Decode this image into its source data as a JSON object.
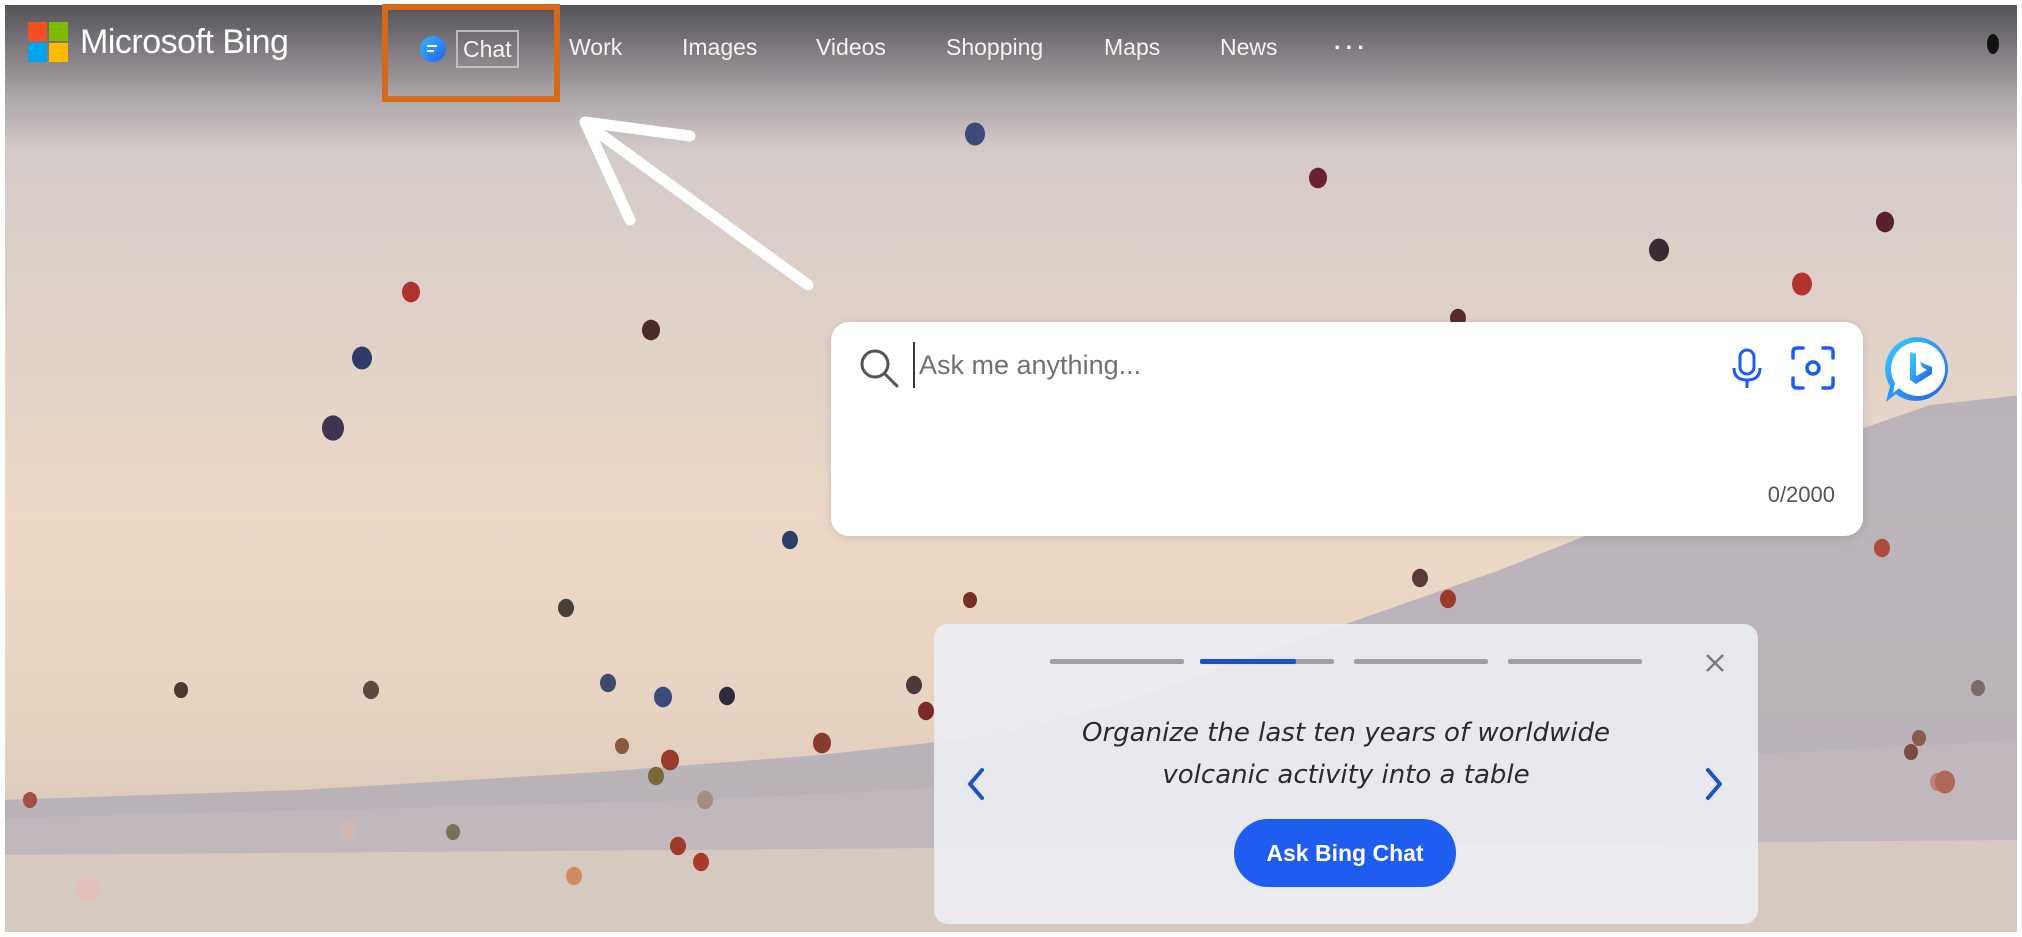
{
  "brand": {
    "name": "Microsoft Bing",
    "logo_colors": [
      "#f25022",
      "#7fba00",
      "#00a4ef",
      "#ffb900"
    ]
  },
  "nav": {
    "items": [
      {
        "label": "Chat",
        "icon": "chat-bubble-icon"
      },
      {
        "label": "Work"
      },
      {
        "label": "Images"
      },
      {
        "label": "Videos"
      },
      {
        "label": "Shopping"
      },
      {
        "label": "Maps"
      },
      {
        "label": "News"
      },
      {
        "label": "···"
      }
    ]
  },
  "annotation": {
    "highlight_color": "#d4691c",
    "arrow_color": "#ffffff"
  },
  "search": {
    "placeholder": "Ask me anything...",
    "value": "",
    "char_count": "0/2000",
    "icons": [
      "search-icon",
      "microphone-icon",
      "visual-search-icon",
      "bing-chat-icon"
    ]
  },
  "prompt_card": {
    "text": "Organize the last ten years of worldwide volcanic activity into a table",
    "button_label": "Ask Bing Chat",
    "slide_count": 4,
    "active_slide": 2,
    "active_progress": 0.72,
    "accent": "#1e5df0"
  }
}
